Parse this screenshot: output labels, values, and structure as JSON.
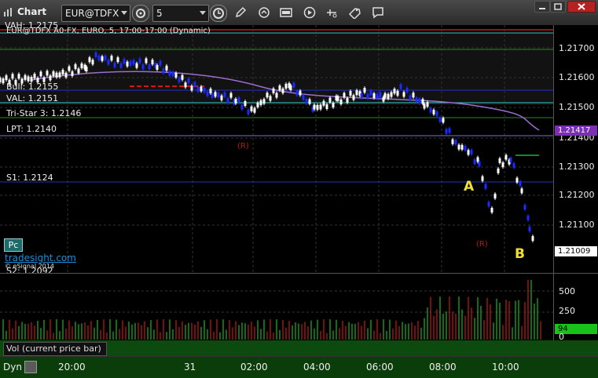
{
  "window": {
    "title": "Chart"
  },
  "toolbar": {
    "symbol": "EUR@TDFX",
    "interval": "5"
  },
  "chart": {
    "info_line": "EUR@TDFX A0-FX, EURO, 5, 17:00-17:00 (Dynamic)",
    "vah_label": "VAH: 1.2175",
    "level_labels": [
      {
        "text": "Bull: 1.2155"
      },
      {
        "text": "VAL: 1.2151"
      },
      {
        "text": "Tri-Star 3: 1.2146"
      },
      {
        "text": "LPT: 1.2140"
      },
      {
        "text": "S1: 1.2124"
      },
      {
        "text": "S2: 1.2092"
      }
    ],
    "pc_tag": "Pc",
    "site_link": "tradesight.com",
    "copyright": "© eSignal 2014",
    "annotation_A": "A",
    "annotation_B": "B",
    "r_marks": [
      "(R)",
      "(R)"
    ],
    "price_ticks": [
      "1.21700",
      "1.21600",
      "1.21500",
      "1.21400",
      "1.21300",
      "1.21200",
      "1.21100"
    ],
    "current_price_tags": [
      {
        "text": "1.21417",
        "bg": "#7a2fb5",
        "fg": "#ffffff"
      },
      {
        "text": "1.21009",
        "bg": "#ffffff",
        "fg": "#000000"
      }
    ],
    "colors": {
      "up_bar": "#ffffff",
      "down_bar": "#1a2cff",
      "vwap": "#9a6fd0",
      "level_blue": "#2230d0",
      "level_green": "#1f8f1f",
      "level_red": "#d01818",
      "level_cyan": "#3bc8c8"
    }
  },
  "volume": {
    "label": "Vol (current price bar)",
    "ticks": [
      "500",
      "250",
      "0"
    ],
    "current_tag": "94"
  },
  "time_axis": {
    "mode_label": "Dyn",
    "labels": [
      "20:00",
      "31",
      "02:00",
      "04:00",
      "06:00",
      "08:00",
      "10:00"
    ]
  }
}
